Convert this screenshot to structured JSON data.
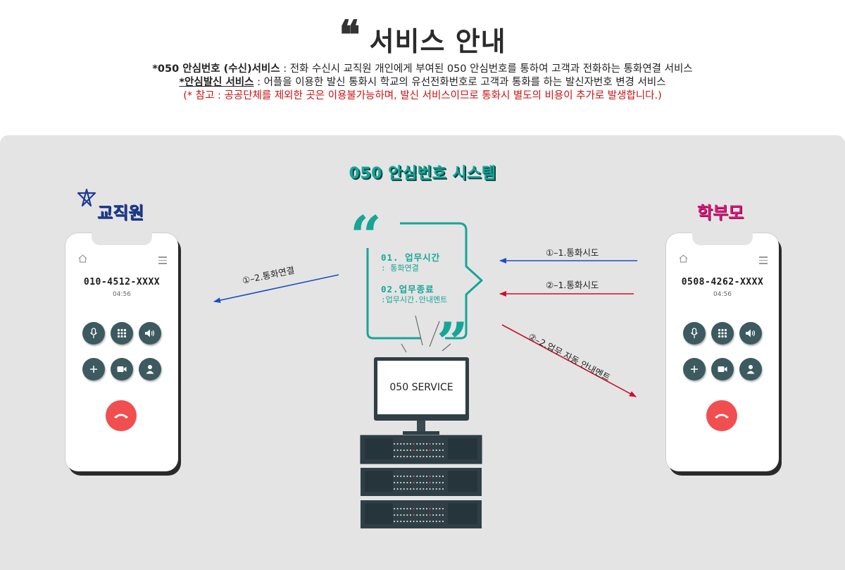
{
  "header": {
    "quote_mark": "❝",
    "title": "서비스 안내",
    "line1_term": "*050 안심번호 (수신)서비스",
    "line1_text": " : 전화 수신시 교직원 개인에게 부여된 050 안심번호를 통하여 고객과 전화하는 통화연결 서비스",
    "line2_term": "*안심발신 서비스",
    "line2_text": " : 어플을 이용한 발신 통화시 학교의 유선전화번호로 고객과 통화를 하는 발신자번호 변경 서비스",
    "line3_note": "(* 참고 : 공공단체를 제외한 곳은 이용불가능하며, 발신 서비스이므로 통화시 별도의 비용이 추가로 발생합니다.)"
  },
  "system": {
    "title": "050 안심번호 시스템",
    "menu": [
      {
        "head": "01. 업무시간",
        "sub": ": 통화연결"
      },
      {
        "head": "02.업무종료",
        "sub": ":업무시간.안내멘트"
      }
    ],
    "server_label": "050 SERVICE"
  },
  "parties": {
    "staff": {
      "label": "교직원",
      "phone_number": "010-4512-XXXX",
      "call_time": "04:56"
    },
    "parent": {
      "label": "학부모",
      "phone_number": "0508-4262-XXXX",
      "call_time": "04:56"
    }
  },
  "arrows": {
    "a1_1": "①–1.통화시도",
    "a2_1": "②–1.통화시도",
    "a1_2": "①–2.통화연결",
    "a2_2": "②–2.업무 자동 안내멘트"
  },
  "colors": {
    "teal": "#17a597",
    "blue_arrow": "#1a4fc4",
    "red_arrow": "#c8102e",
    "staff_label": "#1f3c95",
    "parent_label": "#d8177c",
    "note_red": "#cc1111",
    "hangup": "#f14e50",
    "phone_btn": "#3c5a60"
  },
  "icons": [
    "home-icon",
    "menu-icon",
    "mic-icon",
    "keypad-icon",
    "speaker-icon",
    "add-icon",
    "video-icon",
    "contact-icon",
    "hangup-icon"
  ]
}
